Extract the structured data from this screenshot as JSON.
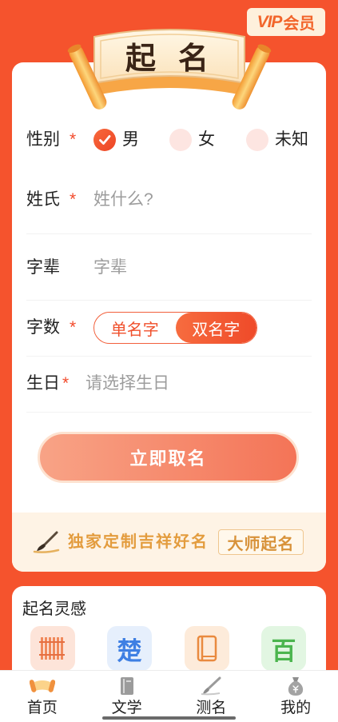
{
  "vip_badge": {
    "prefix": "VIP",
    "label": "会员"
  },
  "banner": {
    "char1": "起",
    "char2": "名"
  },
  "form": {
    "gender": {
      "label": "性别",
      "required": "*",
      "options": [
        {
          "label": "男",
          "checked": true
        },
        {
          "label": "女",
          "checked": false
        },
        {
          "label": "未知",
          "checked": false
        }
      ]
    },
    "surname": {
      "label": "姓氏",
      "required": "*",
      "placeholder": "姓什么?"
    },
    "generation": {
      "label": "字辈",
      "placeholder": "字辈"
    },
    "name_length": {
      "label": "字数",
      "required": "*",
      "options": [
        "单名字",
        "双名字"
      ],
      "selected": 1
    },
    "birthday": {
      "label": "生日",
      "required": "*",
      "placeholder": "请选择生日"
    },
    "submit_label": "立即取名"
  },
  "promo": {
    "icon": "brush-icon",
    "text": "独家定制吉祥好名",
    "button_label": "大师起名"
  },
  "inspiration": {
    "title": "起名灵感",
    "items": [
      {
        "icon": "bamboo-slips-icon"
      },
      {
        "icon": "chu-character-icon",
        "glyph": "楚"
      },
      {
        "icon": "book-icon"
      },
      {
        "icon": "bai-character-icon",
        "glyph": "百"
      }
    ]
  },
  "tabbar": {
    "items": [
      {
        "label": "首页",
        "icon": "scroll-icon",
        "active": true
      },
      {
        "label": "文学",
        "icon": "book-icon",
        "active": false
      },
      {
        "label": "测名",
        "icon": "brush-icon",
        "active": false
      },
      {
        "label": "我的",
        "icon": "money-bag-icon",
        "active": false
      }
    ]
  },
  "colors": {
    "background": "#F5532D",
    "accent": "#F24B2C",
    "promo_text": "#E39C3E",
    "placeholder": "#9C9C9C"
  }
}
